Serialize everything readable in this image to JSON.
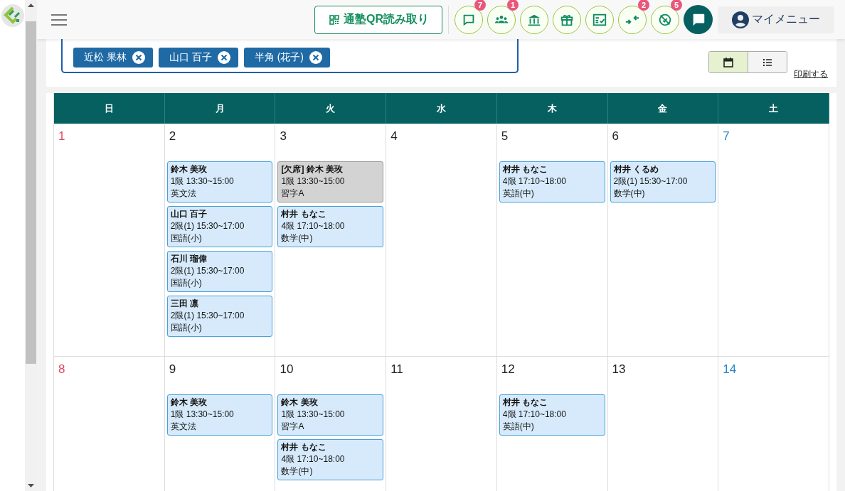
{
  "header": {
    "qr_button": {
      "label": "通塾QR読み取り"
    },
    "icon_buttons": [
      {
        "kind": "chat",
        "badge": "7"
      },
      {
        "kind": "group",
        "badge": "1"
      },
      {
        "kind": "bank"
      },
      {
        "kind": "gift"
      },
      {
        "kind": "checklist"
      },
      {
        "kind": "arrows",
        "badge": "2"
      },
      {
        "kind": "nosign",
        "badge": "5"
      }
    ],
    "my_menu": {
      "label": "マイメニュー"
    }
  },
  "filter_chips": [
    "近松 果林",
    "山口 百子",
    "半角 (花子)"
  ],
  "view_toggle": [
    {
      "kind": "calendar",
      "selected": true
    },
    {
      "kind": "list",
      "selected": false
    }
  ],
  "print_link": "印刷する",
  "weekdays": [
    "日",
    "月",
    "火",
    "水",
    "木",
    "金",
    "土"
  ],
  "weeks": [
    [
      {
        "day": "1",
        "kind": "sunday"
      },
      {
        "day": "2",
        "kind": "weekday",
        "events": [
          {
            "title": "鈴木 美玫",
            "time": "1限 13:30~15:00",
            "subject": "英文法",
            "absent": false
          },
          {
            "title": "山口 百子",
            "time": "2限(1) 15:30~17:00",
            "subject": "国語(小)",
            "absent": false
          },
          {
            "title": "石川 瑠偉",
            "time": "2限(1) 15:30~17:00",
            "subject": "国語(小)",
            "absent": false
          },
          {
            "title": "三田 凛",
            "time": "2限(1) 15:30~17:00",
            "subject": "国語(小)",
            "absent": false
          }
        ]
      },
      {
        "day": "3",
        "kind": "weekday",
        "events": [
          {
            "title": "[欠席] 鈴木 美玫",
            "time": "1限 13:30~15:00",
            "subject": "習字A",
            "absent": true
          },
          {
            "title": "村井 もなこ",
            "time": "4限 17:10~18:00",
            "subject": "数学(中)",
            "absent": false
          }
        ]
      },
      {
        "day": "4",
        "kind": "weekday"
      },
      {
        "day": "5",
        "kind": "weekday",
        "events": [
          {
            "title": "村井 もなこ",
            "time": "4限 17:10~18:00",
            "subject": "英語(中)",
            "absent": false
          }
        ]
      },
      {
        "day": "6",
        "kind": "weekday",
        "events": [
          {
            "title": "村井 くるめ",
            "time": "2限(1) 15:30~17:00",
            "subject": "数学(中)",
            "absent": false
          }
        ]
      },
      {
        "day": "7",
        "kind": "saturday"
      }
    ],
    [
      {
        "day": "8",
        "kind": "sunday"
      },
      {
        "day": "9",
        "kind": "weekday",
        "events": [
          {
            "title": "鈴木 美玫",
            "time": "1限 13:30~15:00",
            "subject": "英文法",
            "absent": false
          }
        ]
      },
      {
        "day": "10",
        "kind": "weekday",
        "events": [
          {
            "title": "鈴木 美玫",
            "time": "1限 13:30~15:00",
            "subject": "習字A",
            "absent": false
          },
          {
            "title": "村井 もなこ",
            "time": "4限 17:10~18:00",
            "subject": "数学(中)",
            "absent": false
          }
        ]
      },
      {
        "day": "11",
        "kind": "weekday"
      },
      {
        "day": "12",
        "kind": "weekday",
        "events": [
          {
            "title": "村井 もなこ",
            "time": "4限 17:10~18:00",
            "subject": "英語(中)",
            "absent": false
          }
        ]
      },
      {
        "day": "13",
        "kind": "weekday"
      },
      {
        "day": "14",
        "kind": "saturday"
      }
    ]
  ]
}
